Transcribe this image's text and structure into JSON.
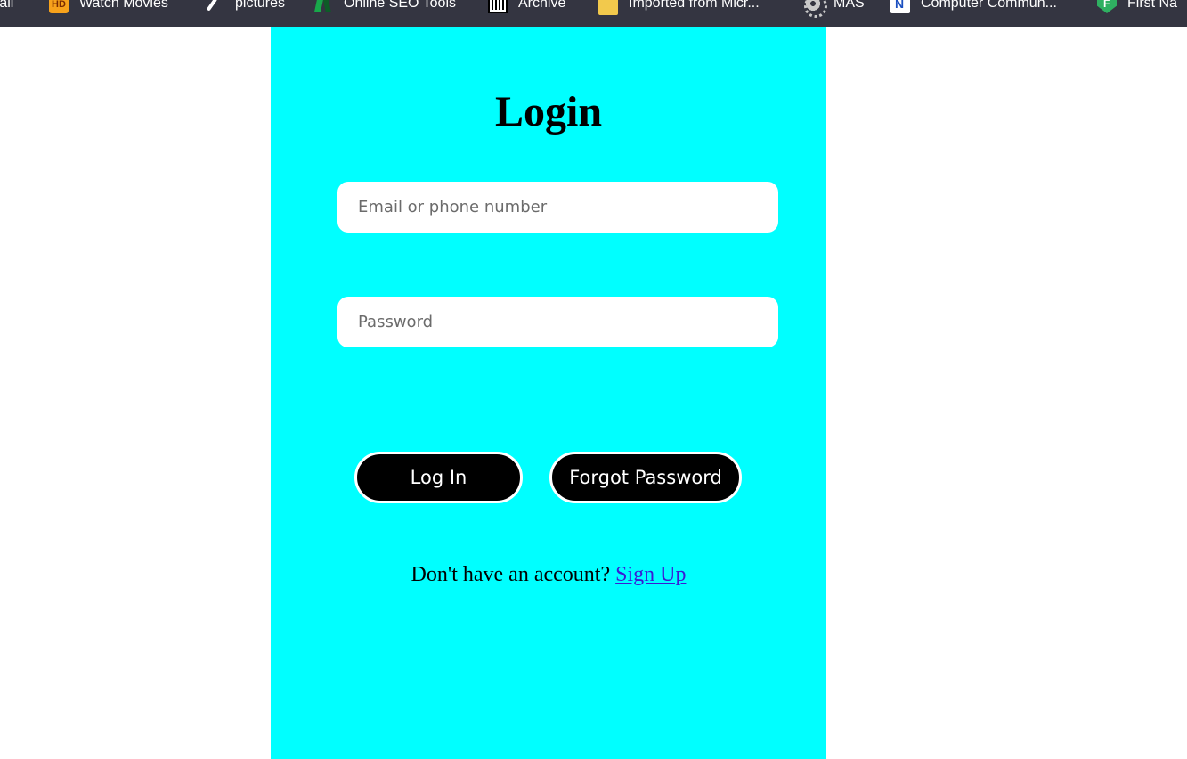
{
  "bookmarks": [
    {
      "label": "Mail",
      "icon": "mail-icon"
    },
    {
      "label": "Watch Movies",
      "icon": "hd-icon"
    },
    {
      "label": "pictures",
      "icon": "pen-icon"
    },
    {
      "label": "Online SEO Tools",
      "icon": "seo-icon"
    },
    {
      "label": "Archive",
      "icon": "archive-icon"
    },
    {
      "label": "Imported from Micr...",
      "icon": "folder-icon"
    },
    {
      "label": "MAS",
      "icon": "gear-icon"
    },
    {
      "label": "Computer Commun...",
      "icon": "n-logo-icon"
    },
    {
      "label": "First Na",
      "icon": "shield-icon"
    }
  ],
  "login": {
    "title": "Login",
    "email_placeholder": "Email or phone number",
    "password_placeholder": "Password",
    "login_label": "Log In",
    "forgot_label": "Forgot Password",
    "signup_prompt": "Don't have an account? ",
    "signup_link": "Sign Up"
  },
  "colors": {
    "panel_background": "#00ffff",
    "bookmarks_bar": "#343541",
    "button_background": "#000000",
    "link": "#3a1bd6"
  }
}
